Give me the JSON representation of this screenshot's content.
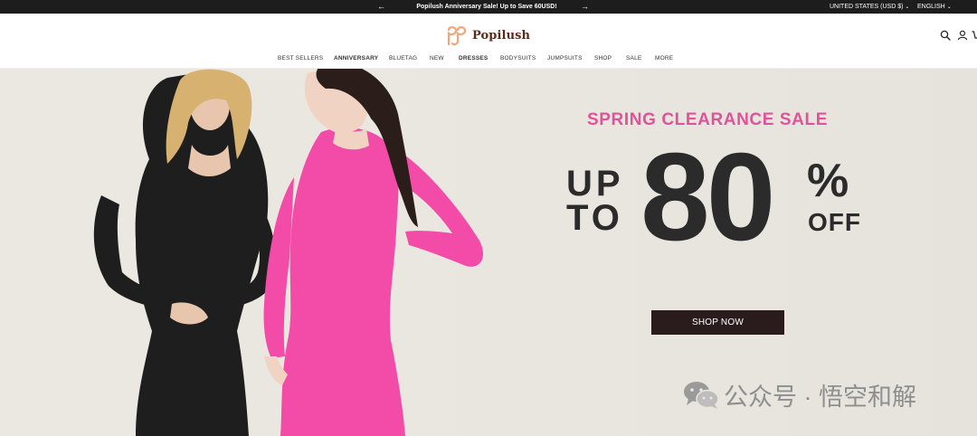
{
  "announcement": {
    "message": "Popilush Anniversary Sale! Up to Save 60USD!",
    "prev_arrow": "←",
    "next_arrow": "→",
    "country": "UNITED STATES (USD $)",
    "language": "ENGLISH"
  },
  "brand": {
    "name": "Popilush",
    "logo_color": "#f0a57a",
    "text_color": "#5a2d1a"
  },
  "header_icons": [
    "search-icon",
    "account-icon",
    "cart-icon"
  ],
  "nav": {
    "items": [
      {
        "label": "BEST SELLERS"
      },
      {
        "label": "ANNIVERSARY"
      },
      {
        "label": "BLUETAG"
      },
      {
        "label": "NEW"
      },
      {
        "label": "DRESSES"
      },
      {
        "label": "BODYSUITS"
      },
      {
        "label": "JUMPSUITS"
      },
      {
        "label": "SHOP"
      },
      {
        "label": "SALE"
      },
      {
        "label": "MORE"
      }
    ]
  },
  "hero": {
    "kicker": "SPRING CLEARANCE SALE",
    "up": "UP",
    "to": "TO",
    "amount": "80",
    "percent": "%",
    "off": "OFF",
    "cta": "SHOP NOW",
    "kicker_color": "#e0529a",
    "cta_color": "#2a1c1c"
  },
  "watermark": {
    "text": "公众号 · 悟空和解"
  }
}
